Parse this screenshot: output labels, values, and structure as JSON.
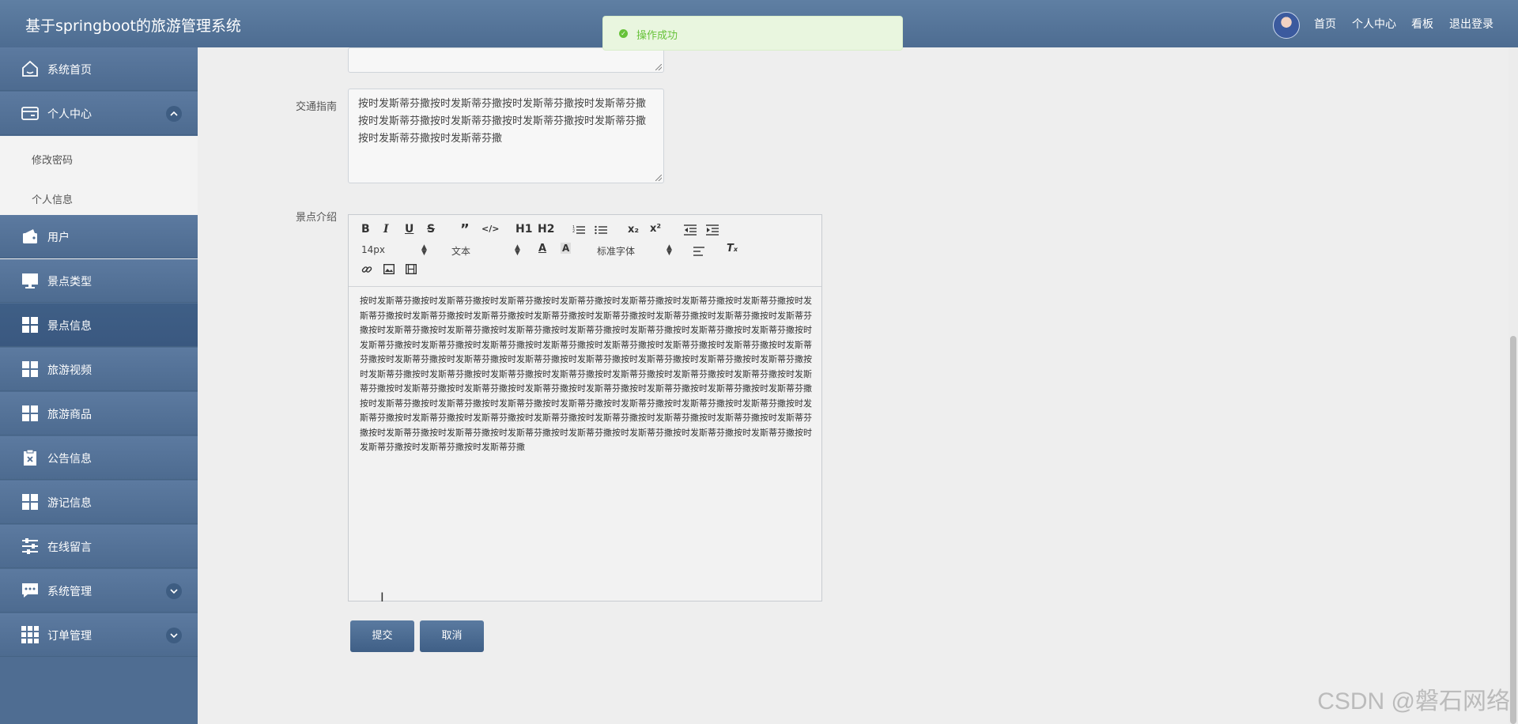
{
  "header": {
    "title": "基于springboot的旅游管理系统",
    "nav": [
      "首页",
      "个人中心",
      "看板",
      "退出登录"
    ]
  },
  "toast": {
    "message": "操作成功",
    "icon": "success-check-icon"
  },
  "sidebar": {
    "items": [
      {
        "label": "系统首页",
        "icon": "home-icon"
      },
      {
        "label": "个人中心",
        "icon": "wallet-card-icon",
        "expanded": true
      },
      {
        "label": "用户",
        "icon": "wallet-icon"
      },
      {
        "label": "景点类型",
        "icon": "monitor-icon"
      },
      {
        "label": "景点信息",
        "icon": "grid-icon",
        "active": true
      },
      {
        "label": "旅游视频",
        "icon": "grid-icon"
      },
      {
        "label": "旅游商品",
        "icon": "grid-icon"
      },
      {
        "label": "公告信息",
        "icon": "clipboard-x-icon"
      },
      {
        "label": "游记信息",
        "icon": "grid-icon"
      },
      {
        "label": "在线留言",
        "icon": "sliders-icon"
      },
      {
        "label": "系统管理",
        "icon": "chat-icon",
        "expandable": true
      },
      {
        "label": "订单管理",
        "icon": "apps-grid-icon",
        "expandable": true
      }
    ],
    "sub_items": [
      "修改密码",
      "个人信息"
    ]
  },
  "form": {
    "traffic_label": "交通指南",
    "traffic_value": "按时发斯蒂芬撒按时发斯蒂芬撒按时发斯蒂芬撒按时发斯蒂芬撒按时发斯蒂芬撒按时发斯蒂芬撒按时发斯蒂芬撒按时发斯蒂芬撒按时发斯蒂芬撒按时发斯蒂芬撒",
    "intro_label": "景点介绍",
    "intro_value": "按时发斯蒂芬撒按时发斯蒂芬撒按时发斯蒂芬撒按时发斯蒂芬撒按时发斯蒂芬撒按时发斯蒂芬撒按时发斯蒂芬撒按时发斯蒂芬撒按时发斯蒂芬撒按时发斯蒂芬撒按时发斯蒂芬撒按时发斯蒂芬撒按时发斯蒂芬撒按时发斯蒂芬撒按时发斯蒂芬撒按时发斯蒂芬撒按时发斯蒂芬撒按时发斯蒂芬撒按时发斯蒂芬撒按时发斯蒂芬撒按时发斯蒂芬撒按时发斯蒂芬撒按时发斯蒂芬撒按时发斯蒂芬撒按时发斯蒂芬撒按时发斯蒂芬撒按时发斯蒂芬撒按时发斯蒂芬撒按时发斯蒂芬撒按时发斯蒂芬撒按时发斯蒂芬撒按时发斯蒂芬撒按时发斯蒂芬撒按时发斯蒂芬撒按时发斯蒂芬撒按时发斯蒂芬撒按时发斯蒂芬撒按时发斯蒂芬撒按时发斯蒂芬撒按时发斯蒂芬撒按时发斯蒂芬撒按时发斯蒂芬撒按时发斯蒂芬撒按时发斯蒂芬撒按时发斯蒂芬撒按时发斯蒂芬撒按时发斯蒂芬撒按时发斯蒂芬撒按时发斯蒂芬撒按时发斯蒂芬撒按时发斯蒂芬撒按时发斯蒂芬撒按时发斯蒂芬撒按时发斯蒂芬撒按时发斯蒂芬撒按时发斯蒂芬撒按时发斯蒂芬撒按时发斯蒂芬撒按时发斯蒂芬撒按时发斯蒂芬撒按时发斯蒂芬撒按时发斯蒂芬撒按时发斯蒂芬撒按时发斯蒂芬撒按时发斯蒂芬撒按时发斯蒂芬撒按时发斯蒂芬撒按时发斯蒂芬撒按时发斯蒂芬撒按时发斯蒂芬撒按时发斯蒂芬撒按时发斯蒂芬撒按时发斯蒂芬撒按时发斯蒂芬撒按时发斯蒂芬撒按时发斯蒂芬撒按时发斯蒂芬撒",
    "submit_label": "提交",
    "cancel_label": "取消"
  },
  "editor_toolbar": {
    "font_size": "14px",
    "block_type": "文本",
    "font_family": "标准字体",
    "h1": "H1",
    "h2": "H2",
    "sub": "x₂",
    "sup": "x²"
  },
  "watermark": "CSDN @磐石网络",
  "colors": {
    "header": "#5f7fa3",
    "sidebar": "#4f6d92",
    "accent": "#3f5f86",
    "success": "#67c23a"
  }
}
